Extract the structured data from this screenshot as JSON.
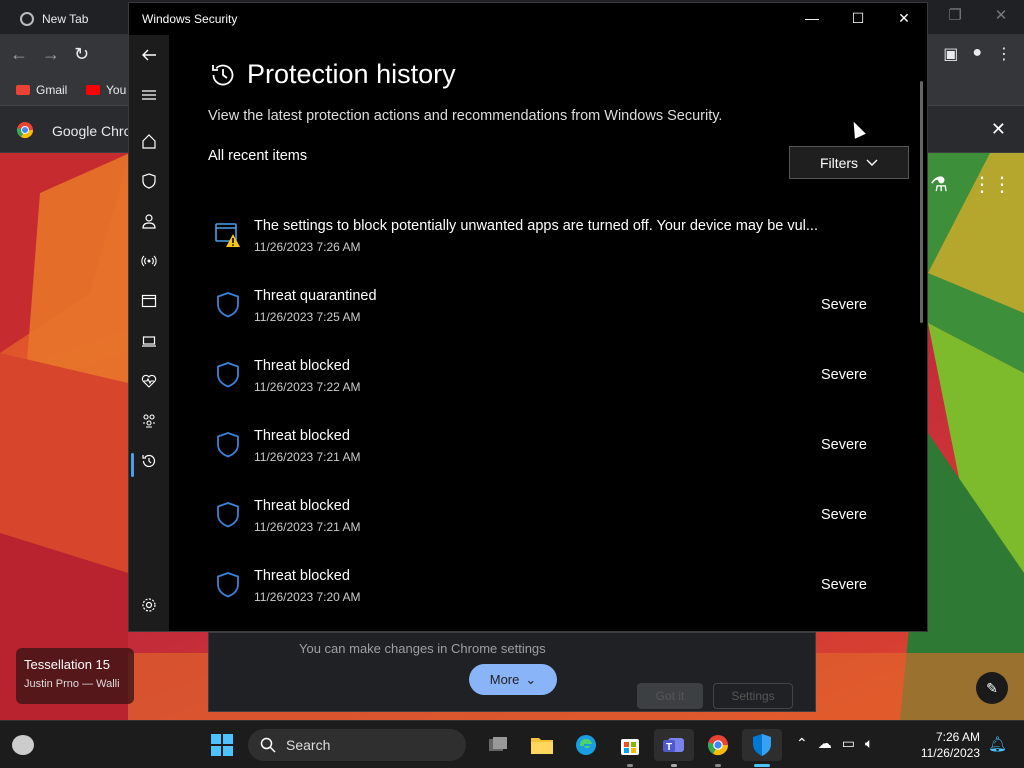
{
  "chrome": {
    "tab_title": "New Tab",
    "bookmarks": [
      "Gmail",
      "You"
    ],
    "infobar_text": "Google Chrom",
    "promo_text": "You can make changes in Chrome settings",
    "more_label": "More",
    "got_it_label": "Got it",
    "settings_label": "Settings"
  },
  "wallpaper_card": {
    "title": "Tessellation 15",
    "author": "Justin Prno — Walli"
  },
  "window": {
    "title": "Windows Security",
    "page_title": "Protection history",
    "description": "View the latest protection actions and recommendations from Windows Security.",
    "section_label": "All recent items",
    "filters_label": "Filters",
    "items": [
      {
        "title": "The settings to block potentially unwanted apps are turned off. Your device may be vul...",
        "date": "11/26/2023 7:26 AM",
        "severity": "",
        "icon": "app-browser-warning-icon"
      },
      {
        "title": "Threat quarantined",
        "date": "11/26/2023 7:25 AM",
        "severity": "Severe",
        "icon": "shield-icon"
      },
      {
        "title": "Threat blocked",
        "date": "11/26/2023 7:22 AM",
        "severity": "Severe",
        "icon": "shield-icon"
      },
      {
        "title": "Threat blocked",
        "date": "11/26/2023 7:21 AM",
        "severity": "Severe",
        "icon": "shield-icon"
      },
      {
        "title": "Threat blocked",
        "date": "11/26/2023 7:21 AM",
        "severity": "Severe",
        "icon": "shield-icon"
      },
      {
        "title": "Threat blocked",
        "date": "11/26/2023 7:20 AM",
        "severity": "Severe",
        "icon": "shield-icon"
      }
    ],
    "sidebar": [
      "back-arrow-icon",
      "hamburger-menu-icon",
      "home-icon",
      "shield-icon",
      "person-icon",
      "wireless-icon",
      "app-browser-icon",
      "laptop-icon",
      "heart-pulse-icon",
      "family-icon",
      "history-icon",
      "settings-gear-icon"
    ]
  },
  "taskbar": {
    "search_placeholder": "Search",
    "time": "7:26 AM",
    "date": "11/26/2023"
  },
  "colors": {
    "accent": "#4a9fe8",
    "shield": "#3b82d6",
    "warning": "#f5c518"
  }
}
